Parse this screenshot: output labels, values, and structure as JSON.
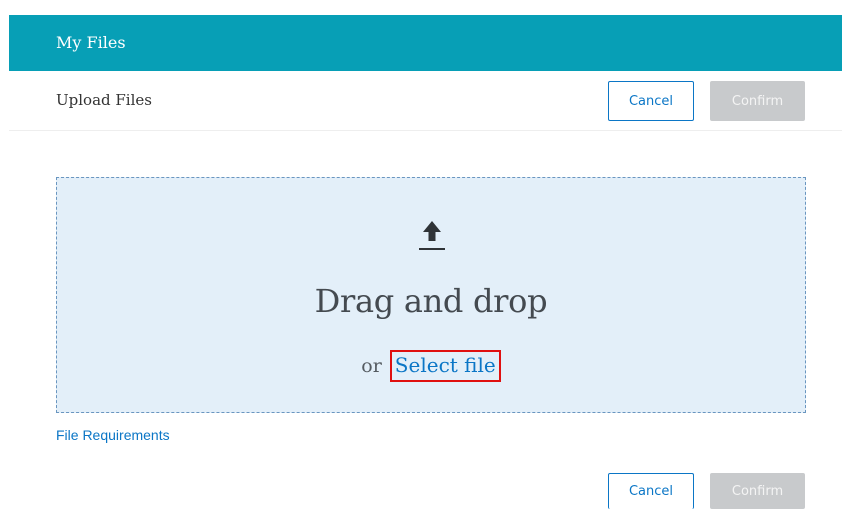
{
  "header": {
    "title": "My Files"
  },
  "subheader": {
    "title": "Upload Files",
    "cancel_label": "Cancel",
    "confirm_label": "Confirm"
  },
  "dropzone": {
    "icon": "upload-icon",
    "headline": "Drag and drop",
    "or_text": "or",
    "select_file_label": "Select file"
  },
  "file_requirements": {
    "label": "File Requirements"
  },
  "footer": {
    "cancel_label": "Cancel",
    "confirm_label": "Confirm"
  },
  "colors": {
    "header_bg": "#079fb6",
    "link": "#0b76c6",
    "dropzone_bg": "#e3eff9",
    "disabled_button": "#c8cacc",
    "highlight_border": "#e01010"
  }
}
